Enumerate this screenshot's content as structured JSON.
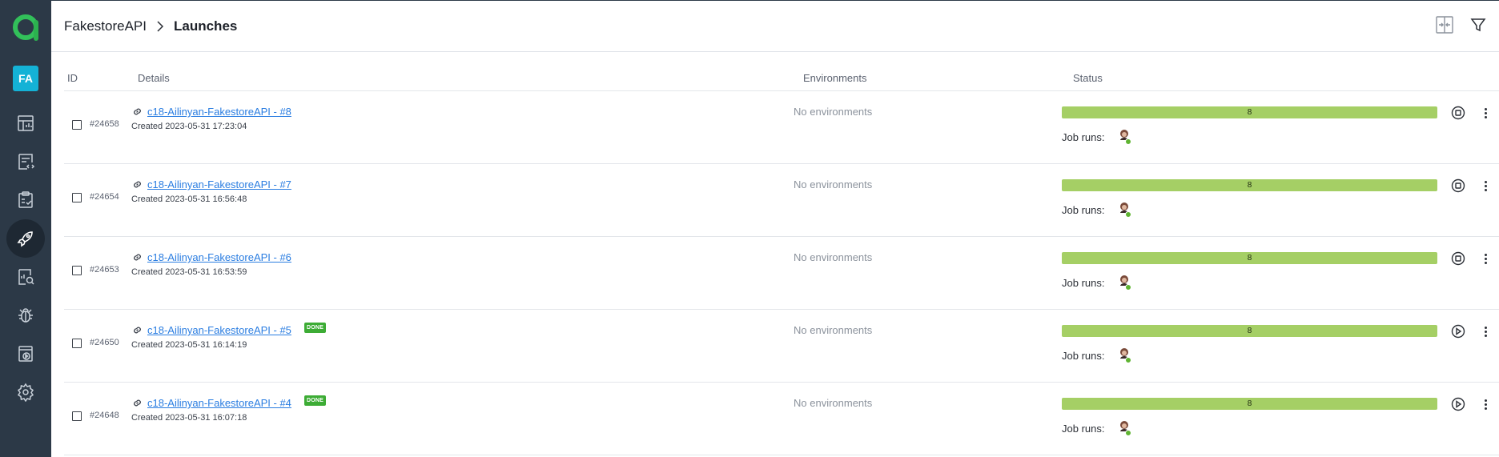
{
  "sidebar": {
    "user_initials": "FA",
    "items": [
      {
        "icon": "dashboard-icon"
      },
      {
        "icon": "test-cases-icon"
      },
      {
        "icon": "test-plans-icon"
      },
      {
        "icon": "launches-icon",
        "active": true
      },
      {
        "icon": "analytics-icon"
      },
      {
        "icon": "defects-icon"
      },
      {
        "icon": "jobs-icon"
      },
      {
        "icon": "settings-icon"
      }
    ]
  },
  "header": {
    "project": "FakestoreAPI",
    "page": "Launches",
    "actions": [
      "compare-icon",
      "filter-icon"
    ]
  },
  "table": {
    "columns": {
      "id": "ID",
      "details": "Details",
      "environments": "Environments",
      "status": "Status"
    },
    "rows": [
      {
        "id": "#24658",
        "name": "c18-Ailinyan-FakestoreAPI - #8",
        "badge": "",
        "created": "Created 2023-05-31 17:23:04",
        "env": "No environments",
        "status_count": "8",
        "job_runs_label": "Job runs:",
        "action": "stop"
      },
      {
        "id": "#24654",
        "name": "c18-Ailinyan-FakestoreAPI - #7",
        "badge": "",
        "created": "Created 2023-05-31 16:56:48",
        "env": "No environments",
        "status_count": "8",
        "job_runs_label": "Job runs:",
        "action": "stop"
      },
      {
        "id": "#24653",
        "name": "c18-Ailinyan-FakestoreAPI - #6",
        "badge": "",
        "created": "Created 2023-05-31 16:53:59",
        "env": "No environments",
        "status_count": "8",
        "job_runs_label": "Job runs:",
        "action": "stop"
      },
      {
        "id": "#24650",
        "name": "c18-Ailinyan-FakestoreAPI - #5",
        "badge": "DONE",
        "created": "Created 2023-05-31 16:14:19",
        "env": "No environments",
        "status_count": "8",
        "job_runs_label": "Job runs:",
        "action": "play"
      },
      {
        "id": "#24648",
        "name": "c18-Ailinyan-FakestoreAPI - #4",
        "badge": "DONE",
        "created": "Created 2023-05-31 16:07:18",
        "env": "No environments",
        "status_count": "8",
        "job_runs_label": "Job runs:",
        "action": "play"
      }
    ]
  },
  "colors": {
    "sidebar_bg": "#2c3947",
    "accent_green": "#3dac35",
    "status_bar": "#a5cf65",
    "link": "#2a7de1",
    "avatar_bg": "#14b2d6"
  }
}
